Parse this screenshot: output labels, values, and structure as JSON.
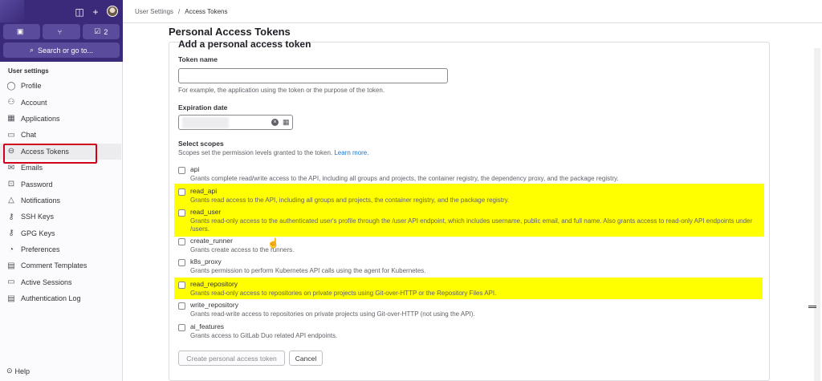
{
  "sidebar": {
    "counts": [
      {
        "icon": "issues-icon",
        "label": ""
      },
      {
        "icon": "merge-request-icon",
        "label": ""
      },
      {
        "icon": "todo-icon",
        "label": "2"
      }
    ],
    "search_label": "Search or go to...",
    "section_title": "User settings",
    "items": [
      {
        "label": "Profile",
        "icon": "profile-icon"
      },
      {
        "label": "Account",
        "icon": "account-icon"
      },
      {
        "label": "Applications",
        "icon": "applications-icon"
      },
      {
        "label": "Chat",
        "icon": "chat-icon"
      },
      {
        "label": "Access Tokens",
        "icon": "token-icon"
      },
      {
        "label": "Emails",
        "icon": "mail-icon"
      },
      {
        "label": "Password",
        "icon": "lock-icon"
      },
      {
        "label": "Notifications",
        "icon": "bell-icon"
      },
      {
        "label": "SSH Keys",
        "icon": "key-icon"
      },
      {
        "label": "GPG Keys",
        "icon": "key-icon"
      },
      {
        "label": "Preferences",
        "icon": "preferences-icon"
      },
      {
        "label": "Comment Templates",
        "icon": "comment-icon"
      },
      {
        "label": "Active Sessions",
        "icon": "monitor-icon"
      },
      {
        "label": "Authentication Log",
        "icon": "log-icon"
      }
    ],
    "help_label": "Help"
  },
  "breadcrumb": {
    "parent": "User Settings",
    "separator": "/",
    "current": "Access Tokens"
  },
  "page_title": "Personal Access Tokens",
  "form": {
    "title": "Add a personal access token",
    "token_name_label": "Token name",
    "token_name_value": "",
    "token_name_help": "For example, the application using the token or the purpose of the token.",
    "expiration_label": "Expiration date",
    "scopes_label": "Select scopes",
    "scopes_help": "Scopes set the permission levels granted to the token.",
    "scopes_link": "Learn more.",
    "scopes": [
      {
        "name": "api",
        "desc": "Grants complete read/write access to the API, including all groups and projects, the container registry, the dependency proxy, and the package registry."
      },
      {
        "name": "read_api",
        "desc": "Grants read access to the API, including all groups and projects, the container registry, and the package registry."
      },
      {
        "name": "read_user",
        "desc": "Grants read-only access to the authenticated user's profile through the /user API endpoint, which includes username, public email, and full name. Also grants access to read-only API endpoints under /users."
      },
      {
        "name": "create_runner",
        "desc": "Grants create access to the runners."
      },
      {
        "name": "k8s_proxy",
        "desc": "Grants permission to perform Kubernetes API calls using the agent for Kubernetes."
      },
      {
        "name": "read_repository",
        "desc": "Grants read-only access to repositories on private projects using Git-over-HTTP or the Repository Files API."
      },
      {
        "name": "write_repository",
        "desc": "Grants read-write access to repositories on private projects using Git-over-HTTP (not using the API)."
      },
      {
        "name": "ai_features",
        "desc": "Grants access to GitLab Duo related API endpoints."
      }
    ],
    "create_button": "Create personal access token",
    "cancel_button": "Cancel"
  },
  "colors": {
    "sidebar_header": "#3b2a79",
    "highlight": "#ffff00",
    "link": "#1f75cb",
    "active_outline": "#d0021b"
  }
}
